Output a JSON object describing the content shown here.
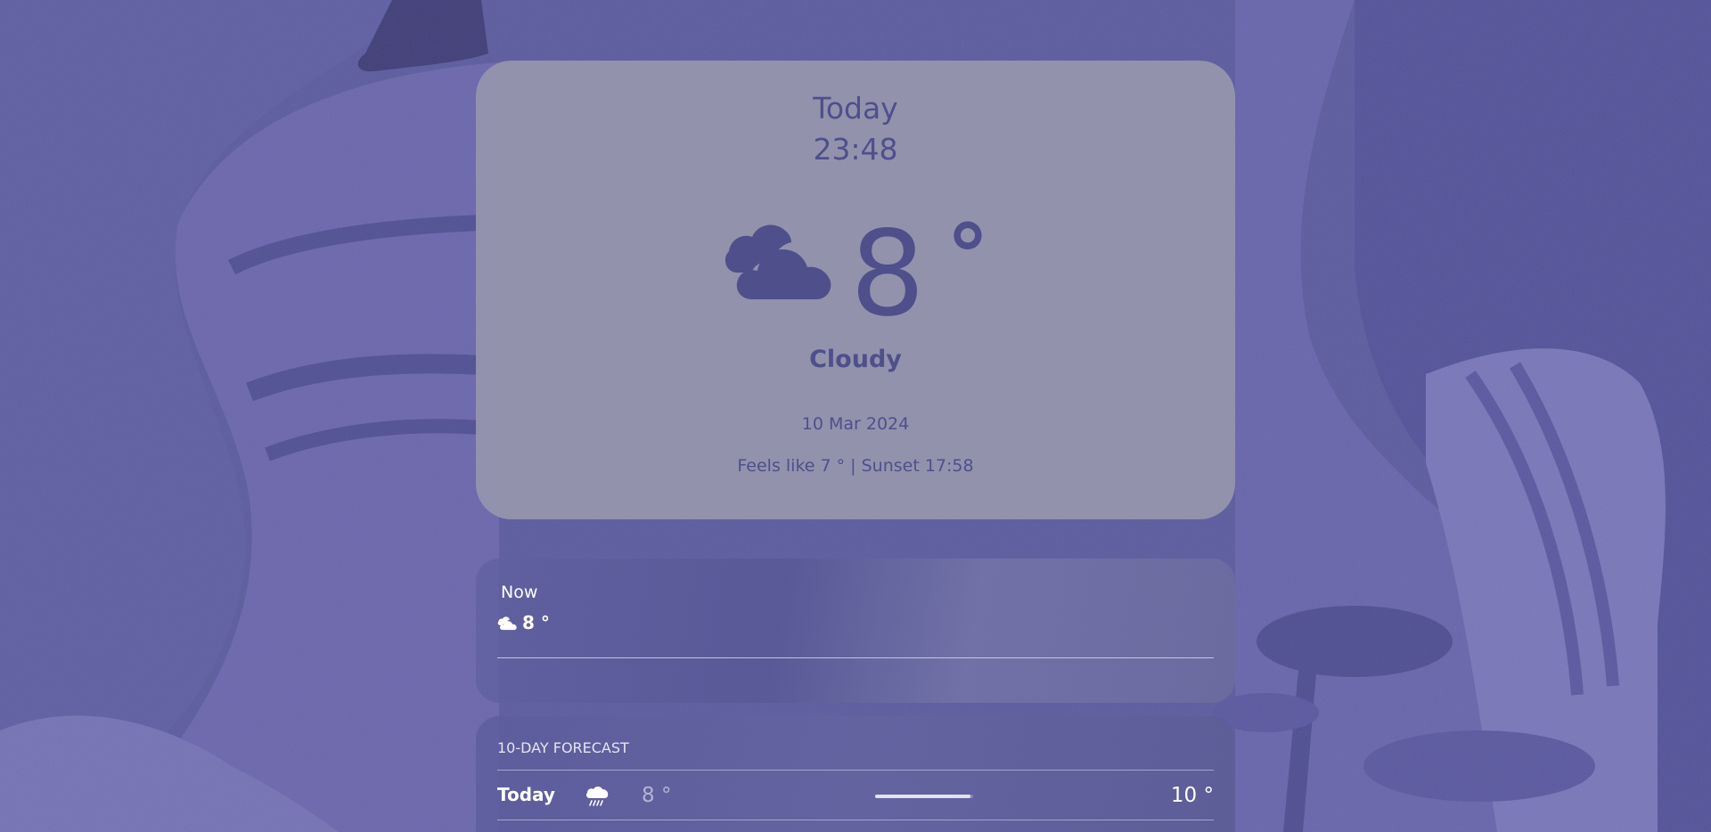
{
  "theme": {
    "background": "#5a5a9e",
    "accent_text": "#4f4f8c",
    "card_light": "#9494ae",
    "text_on_dark": "#ffffff"
  },
  "hero": {
    "day": "Today",
    "time": "23:48",
    "icon": "cloudy-icon",
    "temperature": "8",
    "degree_symbol": "°",
    "condition": "Cloudy",
    "date": "10 Mar 2024",
    "details": "Feels like 7 ° | Sunset 17:58"
  },
  "now": {
    "label": "Now",
    "icon": "cloudy-icon",
    "temperature": "8 °"
  },
  "forecast": {
    "title": "10-DAY FORECAST",
    "rows": [
      {
        "day": "Today",
        "icon": "rain-icon",
        "low": "8 °",
        "high": "10 °",
        "range_fill": 0.97
      }
    ]
  }
}
